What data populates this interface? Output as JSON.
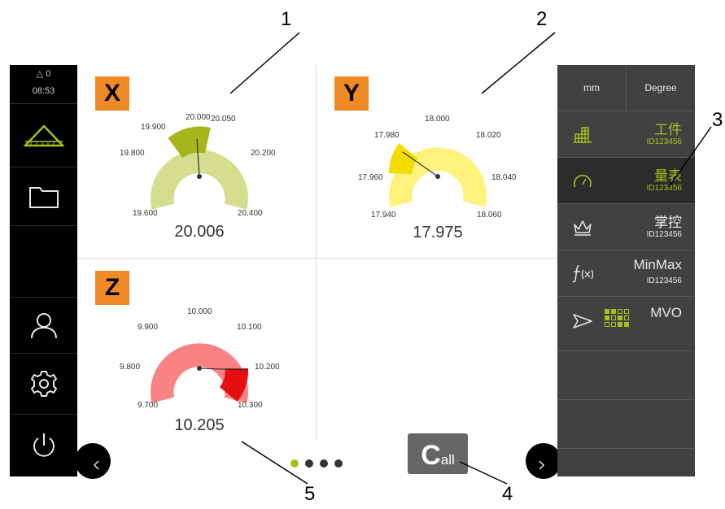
{
  "callouts": [
    "1",
    "2",
    "3",
    "4",
    "5"
  ],
  "status": {
    "warning_count": "△ 0",
    "time": "08:53"
  },
  "units": {
    "length": "mm",
    "angle": "Degree"
  },
  "menu": [
    {
      "title": "工件",
      "sub": "ID123456",
      "icon": "workpiece-grid-icon"
    },
    {
      "title": "量表",
      "sub": "ID123456",
      "icon": "gauge-icon"
    },
    {
      "title": "掌控",
      "sub": "ID123456",
      "icon": "crown-icon"
    },
    {
      "title": "MinMax",
      "sub": "ID123456",
      "icon": "function-fx-icon"
    },
    {
      "title": "MVO",
      "icon": "send-arrow-icon"
    }
  ],
  "gauges": [
    {
      "axis": "X",
      "value": "20.006",
      "ticks": [
        "19.600",
        "19.800",
        "19.900",
        "20.000",
        "20.050",
        "20.200",
        "20.400"
      ],
      "colors": {
        "base": "#d4de8e",
        "highlight": "#a8b51a",
        "badge": "#f08a24"
      }
    },
    {
      "axis": "Y",
      "value": "17.975",
      "ticks": [
        "17.940",
        "17.960",
        "17.980",
        "18.000",
        "18.020",
        "18.040",
        "18.060"
      ],
      "colors": {
        "base": "#fdf27c",
        "highlight": "#f4dc00",
        "badge": "#f08a24"
      }
    },
    {
      "axis": "Z",
      "value": "10.205",
      "ticks": [
        "9.700",
        "9.800",
        "9.900",
        "10.000",
        "10.100",
        "10.200",
        "10.300"
      ],
      "colors": {
        "base": "#f98383",
        "highlight": "#e50f0f",
        "badge": "#f08a24"
      }
    }
  ],
  "call_button": {
    "big": "C",
    "small": "all"
  },
  "pagination": {
    "pages": 4,
    "active": 1
  }
}
